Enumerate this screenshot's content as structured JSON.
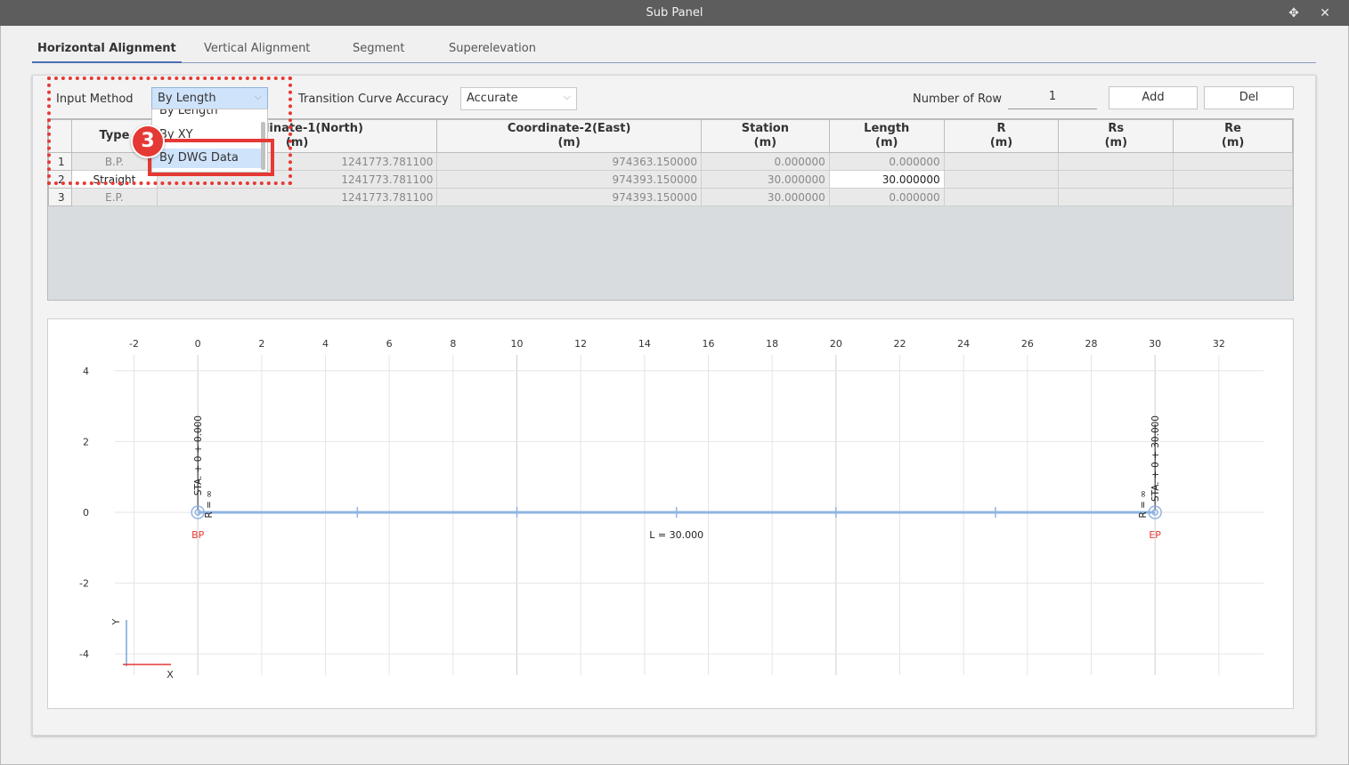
{
  "window": {
    "title": "Sub Panel",
    "pin_icon": "pin-icon",
    "close_icon": "close-icon"
  },
  "tabs": [
    {
      "label": "Horizontal Alignment",
      "active": true
    },
    {
      "label": "Vertical Alignment",
      "active": false
    },
    {
      "label": "Segment",
      "active": false
    },
    {
      "label": "Superelevation",
      "active": false
    }
  ],
  "controls": {
    "input_method_label": "Input Method",
    "input_method_value": "By Length",
    "transition_label": "Transition Curve Accuracy",
    "transition_value": "Accurate",
    "row_count_label": "Number of Row",
    "row_count_value": "1",
    "add_label": "Add",
    "del_label": "Del"
  },
  "dropdown": {
    "items": [
      "By Length",
      "By XY",
      "By DWG Data"
    ],
    "highlighted": "By DWG Data"
  },
  "annotation": {
    "step": "3",
    "color": "#e53935"
  },
  "table": {
    "headers": [
      {
        "line1": "",
        "line2": ""
      },
      {
        "line1": "Type",
        "line2": ""
      },
      {
        "line1": "Coordinate-1(North)",
        "line2": "(m)"
      },
      {
        "line1": "Coordinate-2(East)",
        "line2": "(m)"
      },
      {
        "line1": "Station",
        "line2": "(m)"
      },
      {
        "line1": "Length",
        "line2": "(m)"
      },
      {
        "line1": "R",
        "line2": "(m)"
      },
      {
        "line1": "Rs",
        "line2": "(m)"
      },
      {
        "line1": "Re",
        "line2": "(m)"
      }
    ],
    "rows": [
      {
        "num": "1",
        "type": "B.P.",
        "north": "1241773.781100",
        "east": "974363.150000",
        "station": "0.000000",
        "length": "0.000000",
        "r": "",
        "rs": "",
        "re": ""
      },
      {
        "num": "2",
        "type": "Straight",
        "north": "1241773.781100",
        "east": "974393.150000",
        "station": "30.000000",
        "length": "30.000000",
        "r": "",
        "rs": "",
        "re": ""
      },
      {
        "num": "3",
        "type": "E.P.",
        "north": "1241773.781100",
        "east": "974393.150000",
        "station": "30.000000",
        "length": "0.000000",
        "r": "",
        "rs": "",
        "re": ""
      }
    ]
  },
  "chart_data": {
    "type": "line",
    "x_ticks": [
      "-2",
      "0",
      "2",
      "4",
      "6",
      "8",
      "10",
      "12",
      "14",
      "16",
      "18",
      "20",
      "22",
      "24",
      "26",
      "28",
      "30",
      "32"
    ],
    "y_ticks": [
      "4",
      "2",
      "0",
      "-2",
      "-4"
    ],
    "xlim": [
      -2.6,
      33.4
    ],
    "ylim": [
      -4.6,
      5.1
    ],
    "grid": true,
    "series": [
      {
        "x": [
          0,
          30
        ],
        "y": [
          0,
          0
        ],
        "color": "#8fb4e3"
      }
    ],
    "annotations": {
      "start_station": "STA. + 0 + 0.000",
      "end_station": "STA. + 0 + 30.000",
      "start_radius": "R = ∞",
      "end_radius": "R = ∞",
      "start_point": "BP",
      "end_point": "EP",
      "length": "L = 30.000"
    },
    "axis_labels": {
      "x": "X",
      "y": "Y"
    },
    "point_color": "#e53935"
  }
}
